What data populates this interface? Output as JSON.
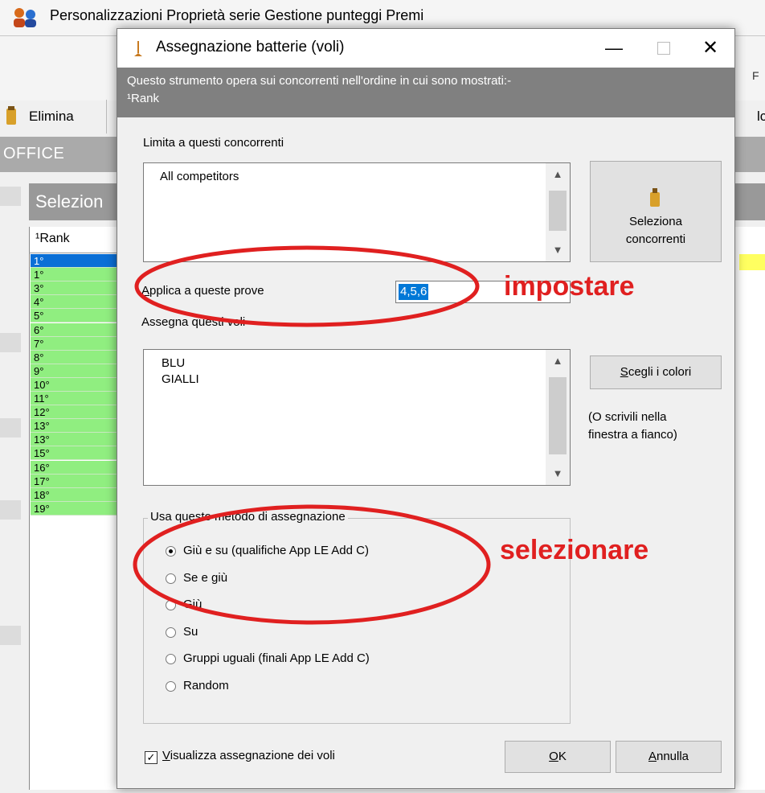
{
  "background": {
    "toolbar_text": "Personalizzazioni   Proprietà serie    Gestione punteggi   Premi",
    "elimina_label": "Elimina",
    "office_label": "OFFICE",
    "selection_panel_label": "Selezion",
    "rank_header": "¹Rank",
    "right_edge_text_1": "F",
    "right_edge_text_2": "lc",
    "ranks": [
      {
        "label": "1°",
        "state": "selected"
      },
      {
        "label": "1°",
        "state": "green"
      },
      {
        "label": "3°",
        "state": "green"
      },
      {
        "label": "4°",
        "state": "green"
      },
      {
        "label": "5°",
        "state": "green"
      },
      {
        "label": "6°",
        "state": "green"
      },
      {
        "label": "7°",
        "state": "green"
      },
      {
        "label": "8°",
        "state": "green"
      },
      {
        "label": "9°",
        "state": "green"
      },
      {
        "label": "10°",
        "state": "green"
      },
      {
        "label": "11°",
        "state": "green"
      },
      {
        "label": "12°",
        "state": "green"
      },
      {
        "label": "13°",
        "state": "green"
      },
      {
        "label": "13°",
        "state": "green"
      },
      {
        "label": "15°",
        "state": "green"
      },
      {
        "label": "16°",
        "state": "green"
      },
      {
        "label": "17°",
        "state": "green"
      },
      {
        "label": "18°",
        "state": "green"
      },
      {
        "label": "19°",
        "state": "green"
      }
    ]
  },
  "dialog": {
    "title": "Assegnazione batterie (voli)",
    "min_glyph": "—",
    "close_glyph": "✕",
    "banner_line1": "Questo strumento opera sui concorrenti nell'ordine in cui sono mostrati:-",
    "banner_line2": "¹Rank",
    "limit_label": "Limita a questi concorrenti",
    "limit_items": [
      "All competitors"
    ],
    "select_button_line1": "Seleziona",
    "select_button_line2": "concorrenti",
    "apply_label": "Applica a queste prove",
    "apply_value": "4,5,6",
    "assign_label": "Assegna questi voli",
    "assign_items": [
      "BLU",
      "GIALLI"
    ],
    "choose_colors_label": "Scegli i colori",
    "note_line1": "(O scrivili nella",
    "note_line2": "finestra a fianco)",
    "method_group_label": "Usa questo metodo di assegnazione",
    "methods": [
      {
        "label": "Giù e su (qualifiche App LE Add C)",
        "selected": true
      },
      {
        "label": "Se e giù",
        "selected": false
      },
      {
        "label": "Giù",
        "selected": false
      },
      {
        "label": "Su",
        "selected": false
      },
      {
        "label": "Gruppi uguali (finali App LE Add C)",
        "selected": false
      },
      {
        "label": "Random",
        "selected": false
      }
    ],
    "visualize_label": "Visualizza assegnazione dei voli",
    "visualize_checked": true,
    "ok_label": "OK",
    "cancel_label": "Annulla"
  },
  "annotations": {
    "set_text": "impostare",
    "select_text": "selezionare",
    "color": "#e02020"
  }
}
